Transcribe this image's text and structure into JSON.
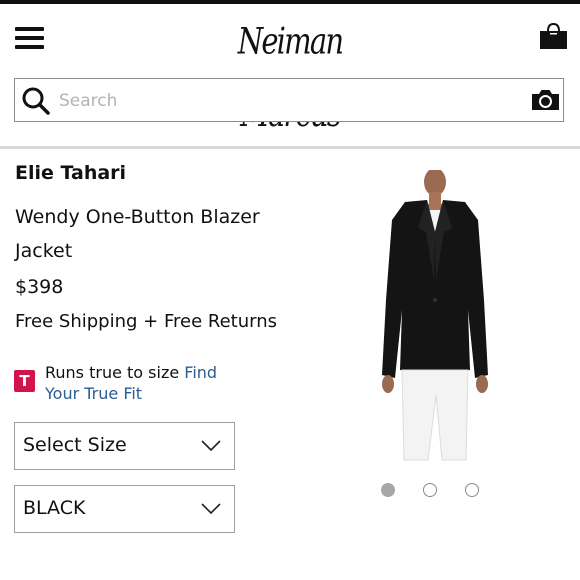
{
  "header": {
    "logo_text": "Neiman Marcus",
    "menu_icon": "hamburger-menu-icon",
    "bag_icon": "shopping-bag-icon"
  },
  "search": {
    "placeholder": "Search",
    "value": "",
    "search_icon": "magnifier-icon",
    "camera_icon": "camera-icon"
  },
  "product": {
    "brand": "Elie Tahari",
    "name": "Wendy One-Button Blazer Jacket",
    "price": "$398",
    "shipping": "Free Shipping + Free Returns",
    "fit": {
      "badge": "T",
      "text": "Runs true to size",
      "link": "Find Your True Fit"
    },
    "size_select": "Select Size",
    "color_select": "BLACK",
    "image_icon": "product-photo-blazer",
    "carousel": {
      "count": 3,
      "active_index": 0
    }
  },
  "colors": {
    "badge": "#d1144a",
    "link": "#2a5c96",
    "active_dot": "#a7a7a7"
  }
}
